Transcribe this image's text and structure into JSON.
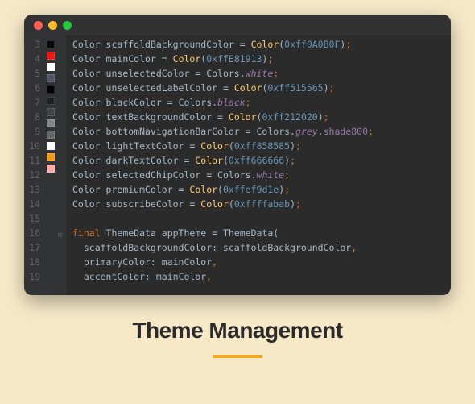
{
  "caption": {
    "title": "Theme Management"
  },
  "traffic": {
    "red": "#ff5f57",
    "yellow": "#febc2e",
    "green": "#28c840"
  },
  "lines": [
    {
      "n": 3,
      "sw": "#0A0B0F",
      "tokens": [
        [
          "kw-type",
          "Color"
        ],
        [
          "ident",
          " scaffoldBackgroundColor "
        ],
        [
          "eq",
          "= "
        ],
        [
          "kw-ctor",
          "Color"
        ],
        [
          "ident",
          "("
        ],
        [
          "num",
          "0xff0A0B0F"
        ],
        [
          "ident",
          ")"
        ],
        [
          "punct",
          ";"
        ]
      ]
    },
    {
      "n": 4,
      "sw": "#E81913",
      "tokens": [
        [
          "kw-type",
          "Color"
        ],
        [
          "ident",
          " mainColor "
        ],
        [
          "eq",
          "= "
        ],
        [
          "kw-ctor",
          "Color"
        ],
        [
          "ident",
          "("
        ],
        [
          "num",
          "0xffE81913"
        ],
        [
          "ident",
          ")"
        ],
        [
          "punct",
          ";"
        ]
      ]
    },
    {
      "n": 5,
      "sw": "#ffffff",
      "tokens": [
        [
          "kw-type",
          "Color"
        ],
        [
          "ident",
          " unselectedColor "
        ],
        [
          "eq",
          "= "
        ],
        [
          "ident",
          "Colors."
        ],
        [
          "static",
          "white"
        ],
        [
          "punct",
          ";"
        ]
      ]
    },
    {
      "n": 6,
      "sw": "#515565",
      "tokens": [
        [
          "kw-type",
          "Color"
        ],
        [
          "ident",
          " unselectedLabelColor "
        ],
        [
          "eq",
          "= "
        ],
        [
          "kw-ctor",
          "Color"
        ],
        [
          "ident",
          "("
        ],
        [
          "num",
          "0xff515565"
        ],
        [
          "ident",
          ")"
        ],
        [
          "punct",
          ";"
        ]
      ]
    },
    {
      "n": 7,
      "sw": "#000000",
      "tokens": [
        [
          "kw-type",
          "Color"
        ],
        [
          "ident",
          " blackColor "
        ],
        [
          "eq",
          "= "
        ],
        [
          "ident",
          "Colors."
        ],
        [
          "static",
          "black"
        ],
        [
          "punct",
          ";"
        ]
      ]
    },
    {
      "n": 8,
      "sw": "#212020",
      "tokens": [
        [
          "kw-type",
          "Color"
        ],
        [
          "ident",
          " textBackgroundColor "
        ],
        [
          "eq",
          "= "
        ],
        [
          "kw-ctor",
          "Color"
        ],
        [
          "ident",
          "("
        ],
        [
          "num",
          "0xff212020"
        ],
        [
          "ident",
          ")"
        ],
        [
          "punct",
          ";"
        ]
      ]
    },
    {
      "n": 9,
      "sw": "#424242",
      "tokens": [
        [
          "kw-type",
          "Color"
        ],
        [
          "ident",
          " bottomNavigationBarColor "
        ],
        [
          "eq",
          "= "
        ],
        [
          "ident",
          "Colors."
        ],
        [
          "static",
          "grey"
        ],
        [
          "ident",
          "."
        ],
        [
          "prop",
          "shade800"
        ],
        [
          "punct",
          ";"
        ]
      ]
    },
    {
      "n": 10,
      "sw": "#858585",
      "tokens": [
        [
          "kw-type",
          "Color"
        ],
        [
          "ident",
          " lightTextColor "
        ],
        [
          "eq",
          "= "
        ],
        [
          "kw-ctor",
          "Color"
        ],
        [
          "ident",
          "("
        ],
        [
          "num",
          "0xff858585"
        ],
        [
          "ident",
          ")"
        ],
        [
          "punct",
          ";"
        ]
      ]
    },
    {
      "n": 11,
      "sw": "#666666",
      "tokens": [
        [
          "kw-type",
          "Color"
        ],
        [
          "ident",
          " darkTextColor "
        ],
        [
          "eq",
          "= "
        ],
        [
          "kw-ctor",
          "Color"
        ],
        [
          "ident",
          "("
        ],
        [
          "num",
          "0xff666666"
        ],
        [
          "ident",
          ")"
        ],
        [
          "punct",
          ";"
        ]
      ]
    },
    {
      "n": 12,
      "sw": "#ffffff",
      "tokens": [
        [
          "kw-type",
          "Color"
        ],
        [
          "ident",
          " selectedChipColor "
        ],
        [
          "eq",
          "= "
        ],
        [
          "ident",
          "Colors."
        ],
        [
          "static",
          "white"
        ],
        [
          "punct",
          ";"
        ]
      ]
    },
    {
      "n": 13,
      "sw": "#ef9d1e",
      "tokens": [
        [
          "kw-type",
          "Color"
        ],
        [
          "ident",
          " premiumColor "
        ],
        [
          "eq",
          "= "
        ],
        [
          "kw-ctor",
          "Color"
        ],
        [
          "ident",
          "("
        ],
        [
          "num",
          "0xffef9d1e"
        ],
        [
          "ident",
          ")"
        ],
        [
          "punct",
          ";"
        ]
      ]
    },
    {
      "n": 14,
      "sw": "#ffabab",
      "tokens": [
        [
          "kw-type",
          "Color"
        ],
        [
          "ident",
          " subscribeColor "
        ],
        [
          "eq",
          "= "
        ],
        [
          "kw-ctor",
          "Color"
        ],
        [
          "ident",
          "("
        ],
        [
          "num",
          "0xffffabab"
        ],
        [
          "ident",
          ")"
        ],
        [
          "punct",
          ";"
        ]
      ]
    },
    {
      "n": 15,
      "sw": null,
      "tokens": [
        [
          "ident",
          ""
        ]
      ]
    },
    {
      "n": 16,
      "sw": null,
      "fold": true,
      "tokens": [
        [
          "kw-final",
          "final"
        ],
        [
          "ident",
          " ThemeData appTheme "
        ],
        [
          "eq",
          "= "
        ],
        [
          "ident",
          "ThemeData("
        ]
      ]
    },
    {
      "n": 17,
      "sw": null,
      "tokens": [
        [
          "ident",
          "  scaffoldBackgroundColor: scaffoldBackgroundColor"
        ],
        [
          "punct",
          ","
        ]
      ]
    },
    {
      "n": 18,
      "sw": null,
      "tokens": [
        [
          "ident",
          "  primaryColor: mainColor"
        ],
        [
          "punct",
          ","
        ]
      ]
    },
    {
      "n": 19,
      "sw": null,
      "tokens": [
        [
          "ident",
          "  accentColor: mainColor"
        ],
        [
          "punct",
          ","
        ]
      ]
    }
  ]
}
